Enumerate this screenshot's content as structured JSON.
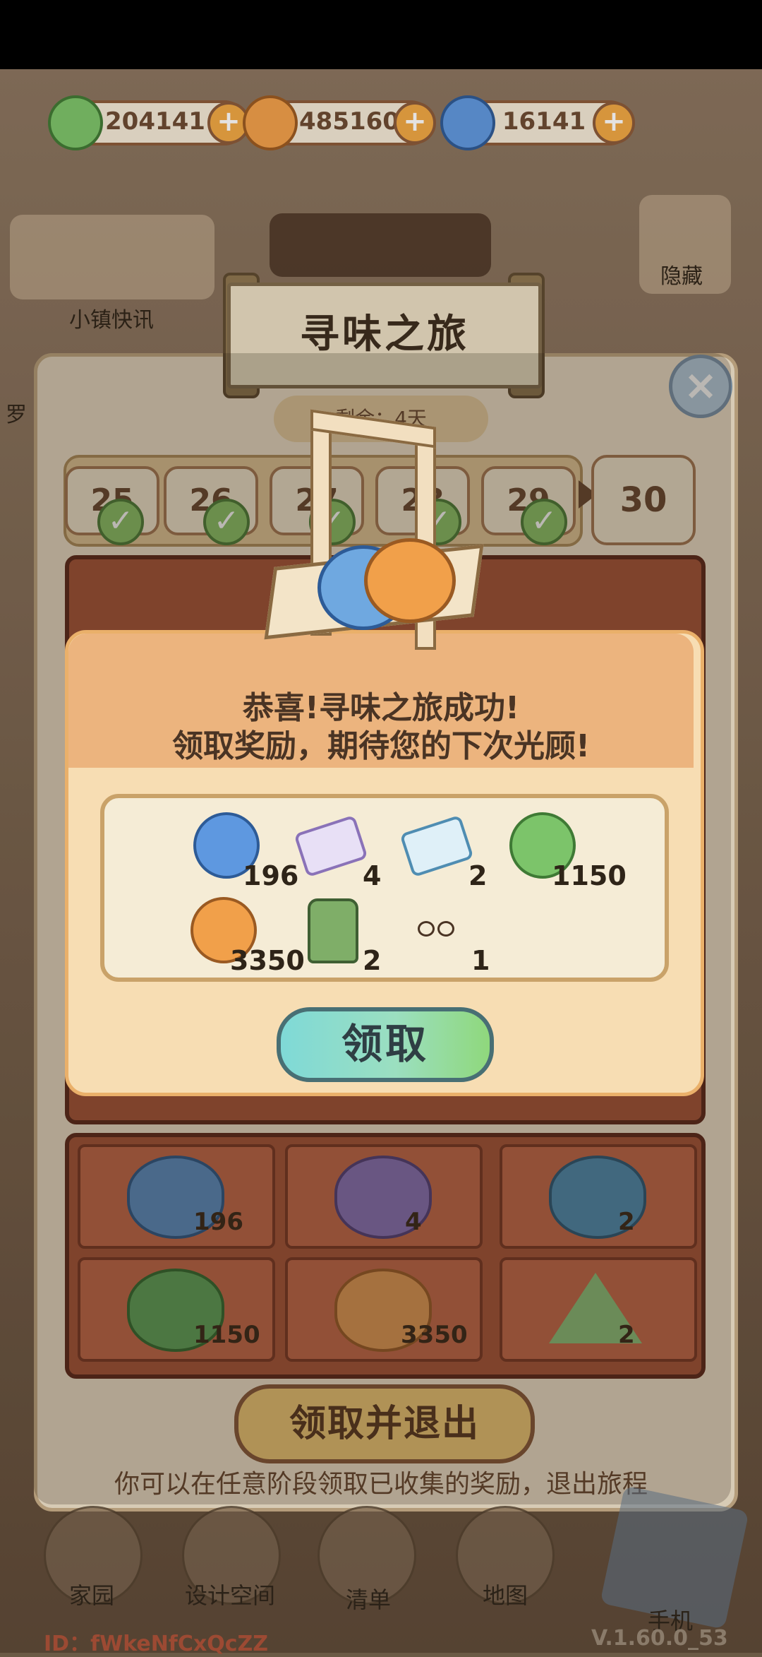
{
  "currencies": [
    {
      "icon": "green-leaf-coin-icon",
      "value": "204141",
      "color": "#7cc46a"
    },
    {
      "icon": "orange-leaf-coin-icon",
      "value": "485160",
      "color": "#f1a04a"
    },
    {
      "icon": "blue-swirl-coin-icon",
      "value": "16141",
      "color": "#5e98e0"
    }
  ],
  "hud": {
    "town_news": "小镇快讯",
    "hide": "隐藏",
    "left_edge": "罗"
  },
  "event": {
    "title": "寻味之旅",
    "remaining": "剩余：4天",
    "days": [
      "25",
      "26",
      "27",
      "28",
      "29"
    ],
    "day_last": "30",
    "close_label": "×"
  },
  "popup": {
    "line1": "恭喜!寻味之旅成功!",
    "line2": "领取奖励，期待您的下次光顾!",
    "rewards": [
      {
        "icon": "blue-swirl-coin-icon",
        "count": "196"
      },
      {
        "icon": "swap-ticket-icon",
        "count": "4"
      },
      {
        "icon": "clock-ticket-icon",
        "count": "2"
      },
      {
        "icon": "green-leaf-coin-icon",
        "count": "1150"
      },
      {
        "icon": "orange-leaf-coin-icon",
        "count": "3350"
      },
      {
        "icon": "lotion-bottle-icon",
        "count": "2"
      },
      {
        "icon": "glasses-icon",
        "count": "1"
      }
    ],
    "claim": "领取"
  },
  "collected": [
    {
      "name": "blue-mooncake",
      "count": "196",
      "color": "#5b8fc4"
    },
    {
      "name": "purple-mooncake",
      "count": "4",
      "color": "#8a72b8"
    },
    {
      "name": "teal-mooncake",
      "count": "2",
      "color": "#4f8db2"
    },
    {
      "name": "green-mooncake",
      "count": "1150",
      "color": "#5fa35a"
    },
    {
      "name": "orange-mooncake",
      "count": "3350",
      "color": "#e09a56"
    },
    {
      "name": "green-tea-pastry",
      "count": "2",
      "color": "#8cbf7a"
    }
  ],
  "claim_exit": "领取并退出",
  "hint": "你可以在任意阶段领取已收集的奖励，退出旅程",
  "nav": [
    "家园",
    "设计空间",
    "清单",
    "地图",
    "手机"
  ],
  "footer": {
    "id": "ID：fWkeNfCxQcZZ",
    "version": "V.1.60.0_53"
  }
}
